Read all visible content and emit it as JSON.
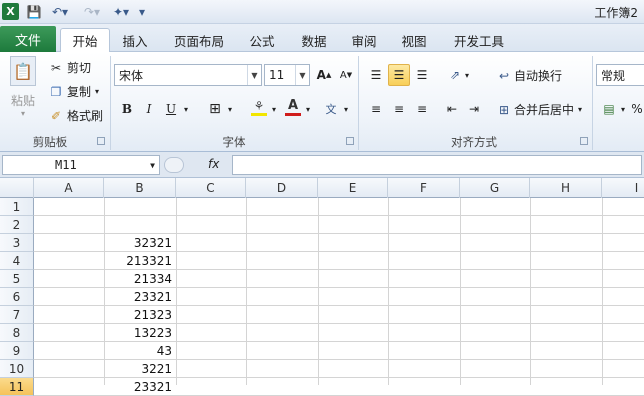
{
  "title_bar": {
    "logo": "X",
    "workbook_title": "工作簿2"
  },
  "tabs": {
    "file": "文件",
    "items": [
      "开始",
      "插入",
      "页面布局",
      "公式",
      "数据",
      "审阅",
      "视图",
      "开发工具"
    ]
  },
  "ribbon": {
    "clipboard": {
      "paste": "粘贴",
      "cut": "剪切",
      "copy": "复制",
      "format_painter": "格式刷",
      "label": "剪贴板"
    },
    "font": {
      "font_name": "宋体",
      "font_size": "11",
      "bold": "B",
      "italic": "I",
      "underline": "U",
      "label": "字体"
    },
    "alignment": {
      "wrap_text": "自动换行",
      "merge_center": "合并后居中",
      "label": "对齐方式"
    },
    "number": {
      "format": "常规"
    }
  },
  "formula_bar": {
    "name_box": "M11",
    "fx": "fx",
    "formula": ""
  },
  "sheet": {
    "columns": [
      "A",
      "B",
      "C",
      "D",
      "E",
      "F",
      "G",
      "H",
      "I"
    ],
    "rows": [
      "1",
      "2",
      "3",
      "4",
      "5",
      "6",
      "7",
      "8",
      "9",
      "10",
      "11"
    ],
    "column_b_values": [
      "",
      "",
      "32321",
      "213321",
      "21334",
      "23321",
      "21323",
      "13223",
      "43",
      "3221",
      "23321"
    ],
    "selected_row": "11"
  },
  "colors": {
    "file_tab": "#1d7a3c",
    "selected_header": "#f5c25a",
    "font_color_underline": "#d01c1c",
    "highlight_underline": "#f2e600"
  }
}
